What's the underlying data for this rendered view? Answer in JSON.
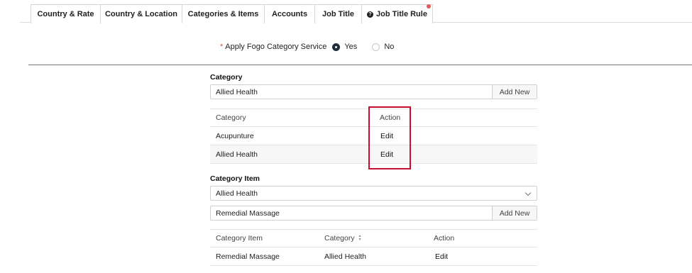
{
  "tabs": [
    {
      "label": "Country & Rate"
    },
    {
      "label": "Country & Location"
    },
    {
      "label": "Categories & Items"
    },
    {
      "label": "Accounts"
    },
    {
      "label": "Job Title"
    },
    {
      "label": "Job Title Rule"
    }
  ],
  "apply_service": {
    "required_mark": "*",
    "label": "Apply Fogo Category Service",
    "options": [
      {
        "label": "Yes",
        "checked": true
      },
      {
        "label": "No",
        "checked": false
      }
    ]
  },
  "category_section": {
    "title": "Category",
    "input_value": "Allied Health",
    "add_label": "Add New",
    "table": {
      "headers": [
        "Category",
        "Action"
      ],
      "rows": [
        {
          "category": "Acupunture",
          "action": "Edit"
        },
        {
          "category": "Allied Health",
          "action": "Edit"
        }
      ]
    }
  },
  "item_section": {
    "title": "Category Item",
    "select_value": "Allied Health",
    "input_value": "Remedial Massage",
    "add_label": "Add New",
    "table": {
      "headers": [
        "Category Item",
        "Category",
        "Action"
      ],
      "rows": [
        {
          "item": "Remedial Massage",
          "category": "Allied Health",
          "action": "Edit"
        }
      ]
    }
  },
  "colors": {
    "highlight": "#c8102e",
    "notification": "#e05a5a",
    "radio_checked": "#1f2d3d"
  }
}
